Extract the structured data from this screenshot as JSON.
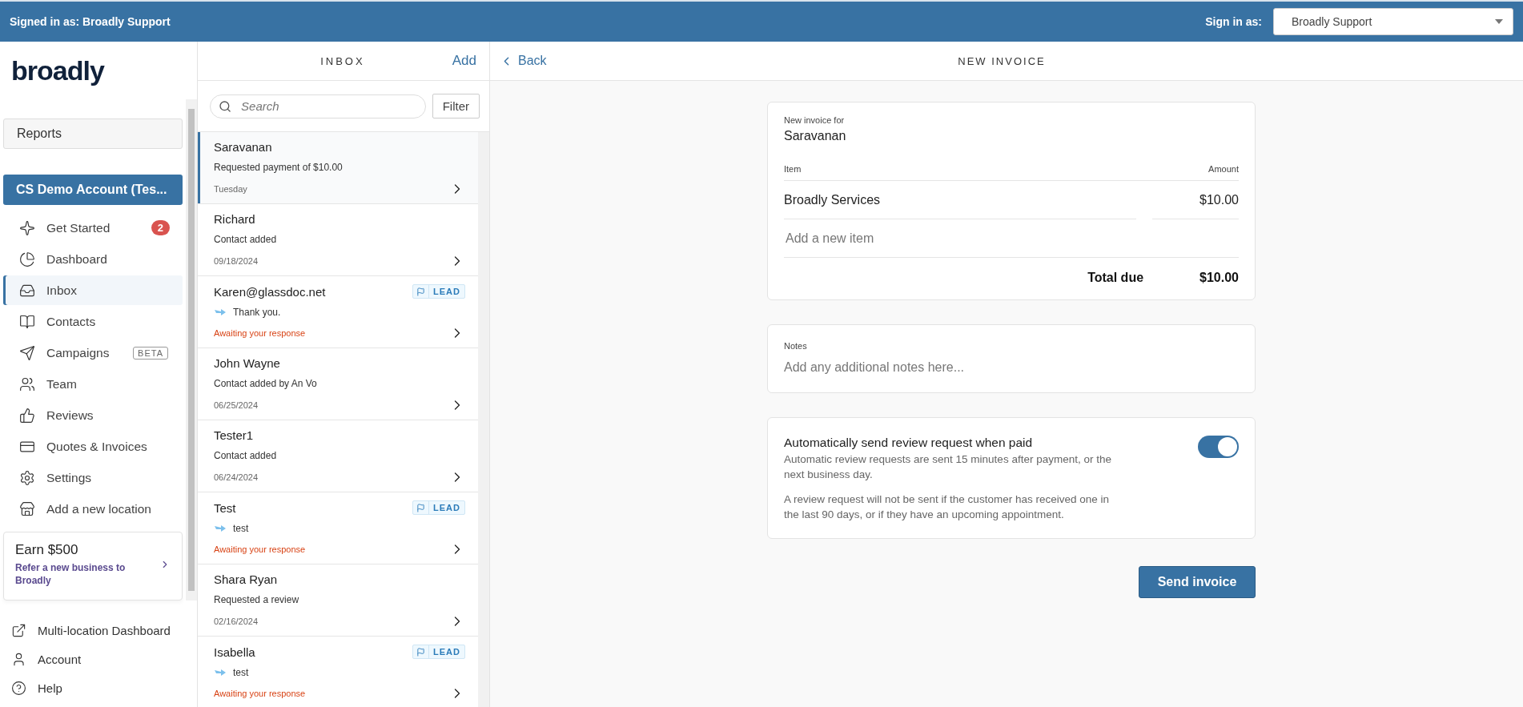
{
  "top_bar": {
    "signed_in": "Signed in as: Broadly Support",
    "sign_in_label": "Sign in as:",
    "sign_in_value": "Broadly Support"
  },
  "sidebar": {
    "logo": "broadly",
    "reports": "Reports",
    "account": "CS Demo Account (Tes...",
    "nav": [
      {
        "label": "Get Started",
        "selected": false,
        "badge": "2"
      },
      {
        "label": "Dashboard",
        "selected": false
      },
      {
        "label": "Inbox",
        "selected": true
      },
      {
        "label": "Contacts",
        "selected": false
      },
      {
        "label": "Campaigns",
        "selected": false,
        "tag": "BETA"
      },
      {
        "label": "Team",
        "selected": false
      },
      {
        "label": "Reviews",
        "selected": false
      },
      {
        "label": "Quotes & Invoices",
        "selected": false
      },
      {
        "label": "Settings",
        "selected": false
      },
      {
        "label": "Add a new location",
        "selected": false
      }
    ],
    "promo": {
      "title": "Earn $500",
      "text": "Refer a new business to Broadly"
    },
    "footer_links": [
      "Multi-location Dashboard",
      "Account",
      "Help"
    ]
  },
  "inbox": {
    "title": "INBOX",
    "add": "Add",
    "search_placeholder": "Search",
    "filter": "Filter",
    "conversations": [
      {
        "name": "Saravanan",
        "preview": "Requested payment of $10.00",
        "footer": "Tuesday",
        "kind": "activity",
        "selected": true
      },
      {
        "name": "Richard",
        "preview": "Contact added",
        "footer": "09/18/2024",
        "kind": "activity",
        "selected": false
      },
      {
        "name": "Karen@glassdoc.net",
        "preview": "Thank you.",
        "footer": "Awaiting your response",
        "kind": "message",
        "tag": "LEAD",
        "selected": false
      },
      {
        "name": "John Wayne",
        "preview": "Contact added by An Vo",
        "footer": "06/25/2024",
        "kind": "activity",
        "selected": false
      },
      {
        "name": "Tester1",
        "preview": "Contact added",
        "footer": "06/24/2024",
        "kind": "activity",
        "selected": false
      },
      {
        "name": "Test",
        "preview": "test",
        "footer": "Awaiting your response",
        "kind": "message",
        "tag": "LEAD",
        "selected": false
      },
      {
        "name": "Shara Ryan",
        "preview": "Requested a review",
        "footer": "02/16/2024",
        "kind": "activity",
        "selected": false
      },
      {
        "name": "Isabella",
        "preview": "test",
        "footer": "Awaiting your response",
        "kind": "message",
        "tag": "LEAD",
        "selected": false
      }
    ]
  },
  "invoice": {
    "back": "Back",
    "title": "NEW INVOICE",
    "for_label": "New invoice for",
    "customer": "Saravanan",
    "columns": [
      "Item",
      "Amount"
    ],
    "items": [
      {
        "name": "Broadly Services",
        "amount": "$10.00"
      }
    ],
    "add_item_placeholder": "Add a new item",
    "total_label": "Total due",
    "total": "$10.00",
    "notes": {
      "label": "Notes",
      "placeholder": "Add any additional notes here..."
    },
    "review": {
      "title": "Automatically send review request when paid",
      "text_1": "Automatic review requests are sent 15 minutes after payment, or the next business day.",
      "text_2": "A review request will not be sent if the customer has received one in the last 90 days, or if they have an upcoming appointment.",
      "on": true
    },
    "send": "Send invoice"
  }
}
